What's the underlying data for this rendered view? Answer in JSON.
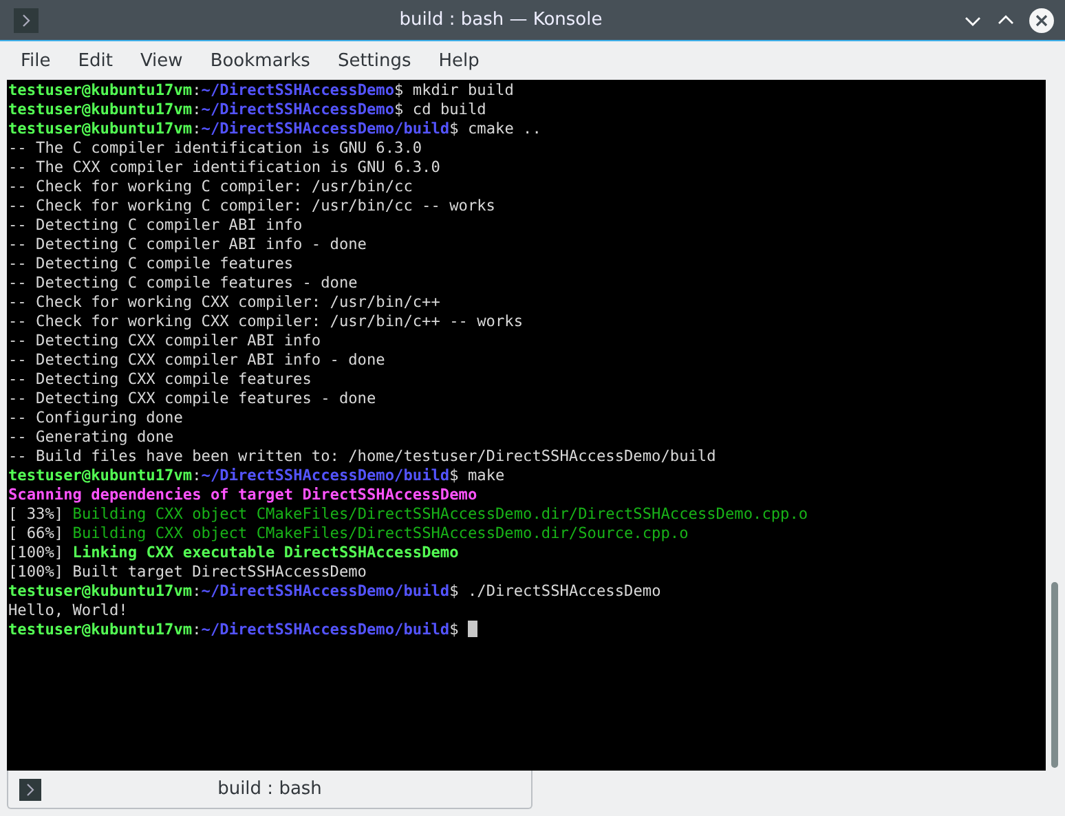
{
  "window": {
    "title": "build : bash — Konsole"
  },
  "menu": [
    "File",
    "Edit",
    "View",
    "Bookmarks",
    "Settings",
    "Help"
  ],
  "terminal": {
    "lines": [
      [
        {
          "kind": "user",
          "text": "testuser@kubuntu17vm"
        },
        {
          "kind": "plain",
          "text": ":"
        },
        {
          "kind": "path",
          "text": "~/DirectSSHAccessDemo"
        },
        {
          "kind": "plain",
          "text": "$ mkdir build"
        }
      ],
      [
        {
          "kind": "user",
          "text": "testuser@kubuntu17vm"
        },
        {
          "kind": "plain",
          "text": ":"
        },
        {
          "kind": "path",
          "text": "~/DirectSSHAccessDemo"
        },
        {
          "kind": "plain",
          "text": "$ cd build"
        }
      ],
      [
        {
          "kind": "user",
          "text": "testuser@kubuntu17vm"
        },
        {
          "kind": "plain",
          "text": ":"
        },
        {
          "kind": "path",
          "text": "~/DirectSSHAccessDemo/build"
        },
        {
          "kind": "plain",
          "text": "$ cmake .."
        }
      ],
      [
        {
          "kind": "plain",
          "text": "-- The C compiler identification is GNU 6.3.0"
        }
      ],
      [
        {
          "kind": "plain",
          "text": "-- The CXX compiler identification is GNU 6.3.0"
        }
      ],
      [
        {
          "kind": "plain",
          "text": "-- Check for working C compiler: /usr/bin/cc"
        }
      ],
      [
        {
          "kind": "plain",
          "text": "-- Check for working C compiler: /usr/bin/cc -- works"
        }
      ],
      [
        {
          "kind": "plain",
          "text": "-- Detecting C compiler ABI info"
        }
      ],
      [
        {
          "kind": "plain",
          "text": "-- Detecting C compiler ABI info - done"
        }
      ],
      [
        {
          "kind": "plain",
          "text": "-- Detecting C compile features"
        }
      ],
      [
        {
          "kind": "plain",
          "text": "-- Detecting C compile features - done"
        }
      ],
      [
        {
          "kind": "plain",
          "text": "-- Check for working CXX compiler: /usr/bin/c++"
        }
      ],
      [
        {
          "kind": "plain",
          "text": "-- Check for working CXX compiler: /usr/bin/c++ -- works"
        }
      ],
      [
        {
          "kind": "plain",
          "text": "-- Detecting CXX compiler ABI info"
        }
      ],
      [
        {
          "kind": "plain",
          "text": "-- Detecting CXX compiler ABI info - done"
        }
      ],
      [
        {
          "kind": "plain",
          "text": "-- Detecting CXX compile features"
        }
      ],
      [
        {
          "kind": "plain",
          "text": "-- Detecting CXX compile features - done"
        }
      ],
      [
        {
          "kind": "plain",
          "text": "-- Configuring done"
        }
      ],
      [
        {
          "kind": "plain",
          "text": "-- Generating done"
        }
      ],
      [
        {
          "kind": "plain",
          "text": "-- Build files have been written to: /home/testuser/DirectSSHAccessDemo/build"
        }
      ],
      [
        {
          "kind": "user",
          "text": "testuser@kubuntu17vm"
        },
        {
          "kind": "plain",
          "text": ":"
        },
        {
          "kind": "path",
          "text": "~/DirectSSHAccessDemo/build"
        },
        {
          "kind": "plain",
          "text": "$ make"
        }
      ],
      [
        {
          "kind": "scan",
          "text": "Scanning dependencies of target DirectSSHAccessDemo"
        }
      ],
      [
        {
          "kind": "plain",
          "text": "[ 33%] "
        },
        {
          "kind": "build",
          "text": "Building CXX object CMakeFiles/DirectSSHAccessDemo.dir/DirectSSHAccessDemo.cpp.o"
        }
      ],
      [
        {
          "kind": "plain",
          "text": "[ 66%] "
        },
        {
          "kind": "build",
          "text": "Building CXX object CMakeFiles/DirectSSHAccessDemo.dir/Source.cpp.o"
        }
      ],
      [
        {
          "kind": "plain",
          "text": "[100%] "
        },
        {
          "kind": "link",
          "text": "Linking CXX executable DirectSSHAccessDemo"
        }
      ],
      [
        {
          "kind": "plain",
          "text": "[100%] Built target DirectSSHAccessDemo"
        }
      ],
      [
        {
          "kind": "user",
          "text": "testuser@kubuntu17vm"
        },
        {
          "kind": "plain",
          "text": ":"
        },
        {
          "kind": "path",
          "text": "~/DirectSSHAccessDemo/build"
        },
        {
          "kind": "plain",
          "text": "$ ./DirectSSHAccessDemo"
        }
      ],
      [
        {
          "kind": "plain",
          "text": "Hello, World!"
        }
      ],
      [
        {
          "kind": "user",
          "text": "testuser@kubuntu17vm"
        },
        {
          "kind": "plain",
          "text": ":"
        },
        {
          "kind": "path",
          "text": "~/DirectSSHAccessDemo/build"
        },
        {
          "kind": "plain",
          "text": "$ "
        },
        {
          "kind": "cursor"
        }
      ]
    ]
  },
  "tabs": [
    {
      "label": "build : bash",
      "selected": true
    }
  ]
}
